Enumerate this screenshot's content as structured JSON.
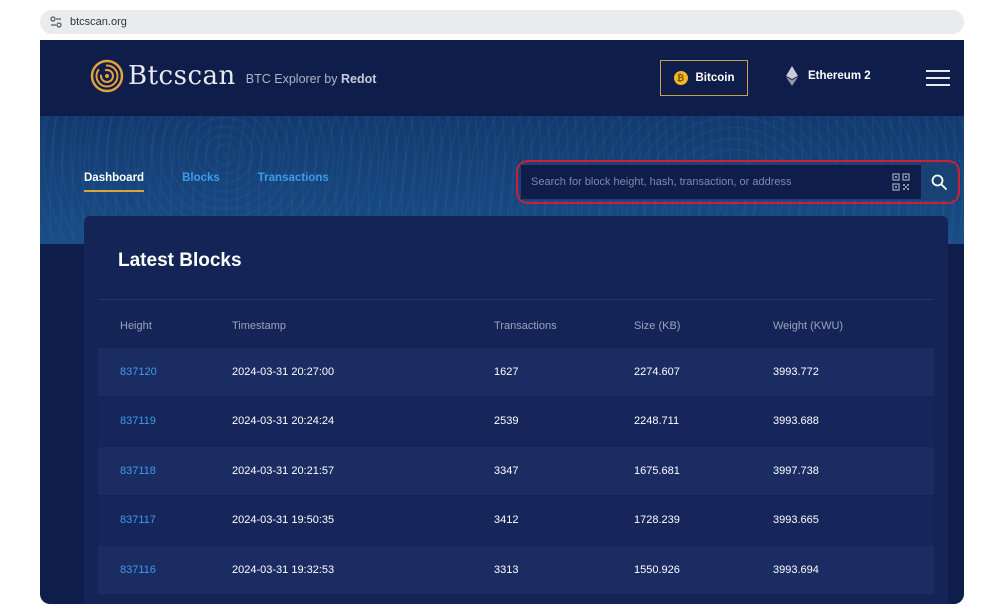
{
  "browser": {
    "url": "btcscan.org"
  },
  "header": {
    "brand": "Btcscan",
    "tagline_prefix": "BTC Explorer by",
    "tagline_owner": "Redot",
    "networks": [
      {
        "label": "Bitcoin",
        "icon": "bitcoin-icon",
        "selected": true
      },
      {
        "label": "Ethereum 2",
        "icon": "ethereum-icon",
        "selected": false
      }
    ]
  },
  "nav": {
    "tabs": [
      {
        "label": "Dashboard",
        "active": true
      },
      {
        "label": "Blocks",
        "active": false
      },
      {
        "label": "Transactions",
        "active": false
      }
    ]
  },
  "search": {
    "placeholder": "Search for block height, hash, transaction, or address"
  },
  "panel": {
    "title": "Latest Blocks",
    "columns": [
      "Height",
      "Timestamp",
      "Transactions",
      "Size (KB)",
      "Weight (KWU)"
    ],
    "rows": [
      [
        "837120",
        "2024-03-31 20:27:00",
        "1627",
        "2274.607",
        "3993.772"
      ],
      [
        "837119",
        "2024-03-31 20:24:24",
        "2539",
        "2248.711",
        "3993.688"
      ],
      [
        "837118",
        "2024-03-31 20:21:57",
        "3347",
        "1675.681",
        "3997.738"
      ],
      [
        "837117",
        "2024-03-31 19:50:35",
        "3412",
        "1728.239",
        "3993.665"
      ],
      [
        "837116",
        "2024-03-31 19:32:53",
        "3313",
        "1550.926",
        "3993.694"
      ]
    ]
  },
  "colors": {
    "background": "#0f1d4a",
    "panel": "#152456",
    "accent_link": "#3d9be9",
    "accent_gold": "#d9a441",
    "highlight_red": "#cf2033"
  }
}
